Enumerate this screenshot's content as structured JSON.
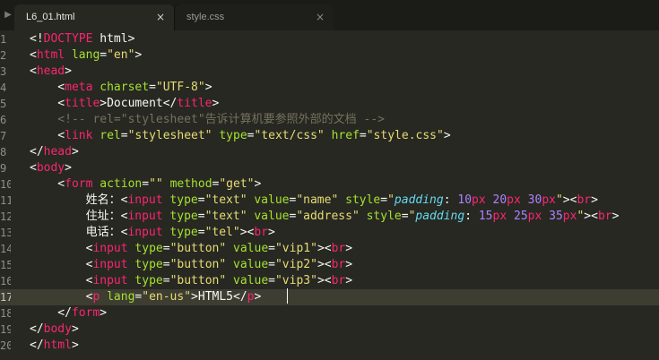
{
  "tabs": [
    {
      "label": "L6_01.html",
      "close": "×",
      "active": true
    },
    {
      "label": "style.css",
      "close": "×",
      "active": false
    }
  ],
  "scroll_arrow": "▶",
  "code_lines": [
    {
      "num": "1",
      "tokens": [
        {
          "t": "<!",
          "c": "text"
        },
        {
          "t": "DOCTYPE",
          "c": "tag"
        },
        {
          "t": " html>",
          "c": "text"
        }
      ]
    },
    {
      "num": "2",
      "tokens": [
        {
          "t": "<",
          "c": "text"
        },
        {
          "t": "html",
          "c": "tag"
        },
        {
          "t": " ",
          "c": "text"
        },
        {
          "t": "lang",
          "c": "attr"
        },
        {
          "t": "=",
          "c": "text"
        },
        {
          "t": "\"en\"",
          "c": "str"
        },
        {
          "t": ">",
          "c": "text"
        }
      ]
    },
    {
      "num": "3",
      "tokens": [
        {
          "t": "<",
          "c": "text"
        },
        {
          "t": "head",
          "c": "tag"
        },
        {
          "t": ">",
          "c": "text"
        }
      ]
    },
    {
      "num": "4",
      "tokens": [
        {
          "t": "    <",
          "c": "text"
        },
        {
          "t": "meta",
          "c": "tag"
        },
        {
          "t": " ",
          "c": "text"
        },
        {
          "t": "charset",
          "c": "attr"
        },
        {
          "t": "=",
          "c": "text"
        },
        {
          "t": "\"UTF-8\"",
          "c": "str"
        },
        {
          "t": ">",
          "c": "text"
        }
      ]
    },
    {
      "num": "5",
      "tokens": [
        {
          "t": "    <",
          "c": "text"
        },
        {
          "t": "title",
          "c": "tag"
        },
        {
          "t": ">Document</",
          "c": "text"
        },
        {
          "t": "title",
          "c": "tag"
        },
        {
          "t": ">",
          "c": "text"
        }
      ]
    },
    {
      "num": "6",
      "tokens": [
        {
          "t": "    <!-- rel=\"stylesheet\"告诉计算机要参照外部的文档 -->",
          "c": "com"
        }
      ]
    },
    {
      "num": "7",
      "tokens": [
        {
          "t": "    <",
          "c": "text"
        },
        {
          "t": "link",
          "c": "tag"
        },
        {
          "t": " ",
          "c": "text"
        },
        {
          "t": "rel",
          "c": "attr"
        },
        {
          "t": "=",
          "c": "text"
        },
        {
          "t": "\"stylesheet\"",
          "c": "str"
        },
        {
          "t": " ",
          "c": "text"
        },
        {
          "t": "type",
          "c": "attr"
        },
        {
          "t": "=",
          "c": "text"
        },
        {
          "t": "\"text/css\"",
          "c": "str"
        },
        {
          "t": " ",
          "c": "text"
        },
        {
          "t": "href",
          "c": "attr"
        },
        {
          "t": "=",
          "c": "text"
        },
        {
          "t": "\"style.css\"",
          "c": "str"
        },
        {
          "t": ">",
          "c": "text"
        }
      ]
    },
    {
      "num": "8",
      "tokens": [
        {
          "t": "</",
          "c": "text"
        },
        {
          "t": "head",
          "c": "tag"
        },
        {
          "t": ">",
          "c": "text"
        }
      ]
    },
    {
      "num": "9",
      "tokens": [
        {
          "t": "<",
          "c": "text"
        },
        {
          "t": "body",
          "c": "tag"
        },
        {
          "t": ">",
          "c": "text"
        }
      ]
    },
    {
      "num": "10",
      "tokens": [
        {
          "t": "    <",
          "c": "text"
        },
        {
          "t": "form",
          "c": "tag"
        },
        {
          "t": " ",
          "c": "text"
        },
        {
          "t": "action",
          "c": "attr"
        },
        {
          "t": "=",
          "c": "text"
        },
        {
          "t": "\"\"",
          "c": "str"
        },
        {
          "t": " ",
          "c": "text"
        },
        {
          "t": "method",
          "c": "attr"
        },
        {
          "t": "=",
          "c": "text"
        },
        {
          "t": "\"get\"",
          "c": "str"
        },
        {
          "t": ">",
          "c": "text"
        }
      ]
    },
    {
      "num": "11",
      "tokens": [
        {
          "t": "        姓名：<",
          "c": "text"
        },
        {
          "t": "input",
          "c": "tag"
        },
        {
          "t": " ",
          "c": "text"
        },
        {
          "t": "type",
          "c": "attr"
        },
        {
          "t": "=",
          "c": "text"
        },
        {
          "t": "\"text\"",
          "c": "str"
        },
        {
          "t": " ",
          "c": "text"
        },
        {
          "t": "value",
          "c": "attr"
        },
        {
          "t": "=",
          "c": "text"
        },
        {
          "t": "\"name\"",
          "c": "str"
        },
        {
          "t": " ",
          "c": "text"
        },
        {
          "t": "style",
          "c": "attr"
        },
        {
          "t": "=",
          "c": "text"
        },
        {
          "t": "\"",
          "c": "str"
        },
        {
          "t": "padding",
          "c": "prop"
        },
        {
          "t": ": ",
          "c": "text"
        },
        {
          "t": "10",
          "c": "num"
        },
        {
          "t": "px",
          "c": "kw"
        },
        {
          "t": " ",
          "c": "text"
        },
        {
          "t": "20",
          "c": "num"
        },
        {
          "t": "px",
          "c": "kw"
        },
        {
          "t": " ",
          "c": "text"
        },
        {
          "t": "30",
          "c": "num"
        },
        {
          "t": "px",
          "c": "kw"
        },
        {
          "t": "\"",
          "c": "str"
        },
        {
          "t": "><",
          "c": "text"
        },
        {
          "t": "br",
          "c": "tag"
        },
        {
          "t": ">",
          "c": "text"
        }
      ]
    },
    {
      "num": "12",
      "tokens": [
        {
          "t": "        住址：<",
          "c": "text"
        },
        {
          "t": "input",
          "c": "tag"
        },
        {
          "t": " ",
          "c": "text"
        },
        {
          "t": "type",
          "c": "attr"
        },
        {
          "t": "=",
          "c": "text"
        },
        {
          "t": "\"text\"",
          "c": "str"
        },
        {
          "t": " ",
          "c": "text"
        },
        {
          "t": "value",
          "c": "attr"
        },
        {
          "t": "=",
          "c": "text"
        },
        {
          "t": "\"address\"",
          "c": "str"
        },
        {
          "t": " ",
          "c": "text"
        },
        {
          "t": "style",
          "c": "attr"
        },
        {
          "t": "=",
          "c": "text"
        },
        {
          "t": "\"",
          "c": "str"
        },
        {
          "t": "padding",
          "c": "prop"
        },
        {
          "t": ": ",
          "c": "text"
        },
        {
          "t": "15",
          "c": "num"
        },
        {
          "t": "px",
          "c": "kw"
        },
        {
          "t": " ",
          "c": "text"
        },
        {
          "t": "25",
          "c": "num"
        },
        {
          "t": "px",
          "c": "kw"
        },
        {
          "t": " ",
          "c": "text"
        },
        {
          "t": "35",
          "c": "num"
        },
        {
          "t": "px",
          "c": "kw"
        },
        {
          "t": "\"",
          "c": "str"
        },
        {
          "t": "><",
          "c": "text"
        },
        {
          "t": "br",
          "c": "tag"
        },
        {
          "t": ">",
          "c": "text"
        }
      ]
    },
    {
      "num": "13",
      "tokens": [
        {
          "t": "        电话：<",
          "c": "text"
        },
        {
          "t": "input",
          "c": "tag"
        },
        {
          "t": " ",
          "c": "text"
        },
        {
          "t": "type",
          "c": "attr"
        },
        {
          "t": "=",
          "c": "text"
        },
        {
          "t": "\"tel\"",
          "c": "str"
        },
        {
          "t": "><",
          "c": "text"
        },
        {
          "t": "br",
          "c": "tag"
        },
        {
          "t": ">",
          "c": "text"
        }
      ]
    },
    {
      "num": "14",
      "tokens": [
        {
          "t": "        <",
          "c": "text"
        },
        {
          "t": "input",
          "c": "tag"
        },
        {
          "t": " ",
          "c": "text"
        },
        {
          "t": "type",
          "c": "attr"
        },
        {
          "t": "=",
          "c": "text"
        },
        {
          "t": "\"button\"",
          "c": "str"
        },
        {
          "t": " ",
          "c": "text"
        },
        {
          "t": "value",
          "c": "attr"
        },
        {
          "t": "=",
          "c": "text"
        },
        {
          "t": "\"vip1\"",
          "c": "str"
        },
        {
          "t": "><",
          "c": "text"
        },
        {
          "t": "br",
          "c": "tag"
        },
        {
          "t": ">",
          "c": "text"
        }
      ]
    },
    {
      "num": "15",
      "tokens": [
        {
          "t": "        <",
          "c": "text"
        },
        {
          "t": "input",
          "c": "tag"
        },
        {
          "t": " ",
          "c": "text"
        },
        {
          "t": "type",
          "c": "attr"
        },
        {
          "t": "=",
          "c": "text"
        },
        {
          "t": "\"button\"",
          "c": "str"
        },
        {
          "t": " ",
          "c": "text"
        },
        {
          "t": "value",
          "c": "attr"
        },
        {
          "t": "=",
          "c": "text"
        },
        {
          "t": "\"vip2\"",
          "c": "str"
        },
        {
          "t": "><",
          "c": "text"
        },
        {
          "t": "br",
          "c": "tag"
        },
        {
          "t": ">",
          "c": "text"
        }
      ]
    },
    {
      "num": "16",
      "tokens": [
        {
          "t": "        <",
          "c": "text"
        },
        {
          "t": "input",
          "c": "tag"
        },
        {
          "t": " ",
          "c": "text"
        },
        {
          "t": "type",
          "c": "attr"
        },
        {
          "t": "=",
          "c": "text"
        },
        {
          "t": "\"button\"",
          "c": "str"
        },
        {
          "t": " ",
          "c": "text"
        },
        {
          "t": "value",
          "c": "attr"
        },
        {
          "t": "=",
          "c": "text"
        },
        {
          "t": "\"vip3\"",
          "c": "str"
        },
        {
          "t": "><",
          "c": "text"
        },
        {
          "t": "br",
          "c": "tag"
        },
        {
          "t": ">",
          "c": "text"
        }
      ]
    },
    {
      "num": "17",
      "current": true,
      "tokens": [
        {
          "t": "        <",
          "c": "text"
        },
        {
          "t": "p",
          "c": "tag"
        },
        {
          "t": " ",
          "c": "text"
        },
        {
          "t": "lang",
          "c": "attr"
        },
        {
          "t": "=",
          "c": "text"
        },
        {
          "t": "\"en-us\"",
          "c": "str"
        },
        {
          "t": ">HTML5</",
          "c": "text"
        },
        {
          "t": "p",
          "c": "tag"
        },
        {
          "t": ">",
          "c": "text"
        }
      ]
    },
    {
      "num": "18",
      "tokens": [
        {
          "t": "    </",
          "c": "text"
        },
        {
          "t": "form",
          "c": "tag"
        },
        {
          "t": ">",
          "c": "text"
        }
      ]
    },
    {
      "num": "19",
      "tokens": [
        {
          "t": "</",
          "c": "text"
        },
        {
          "t": "body",
          "c": "tag"
        },
        {
          "t": ">",
          "c": "text"
        }
      ]
    },
    {
      "num": "20",
      "tokens": [
        {
          "t": "</",
          "c": "text"
        },
        {
          "t": "html",
          "c": "tag"
        },
        {
          "t": ">",
          "c": "text"
        }
      ]
    }
  ],
  "colors": {
    "background": "#272822",
    "tag": "#f92672",
    "attribute": "#a6e22e",
    "string": "#e6db74",
    "comment": "#75715e",
    "property": "#66d9ef",
    "number": "#ae81ff",
    "current_line": "#3e3d32"
  }
}
